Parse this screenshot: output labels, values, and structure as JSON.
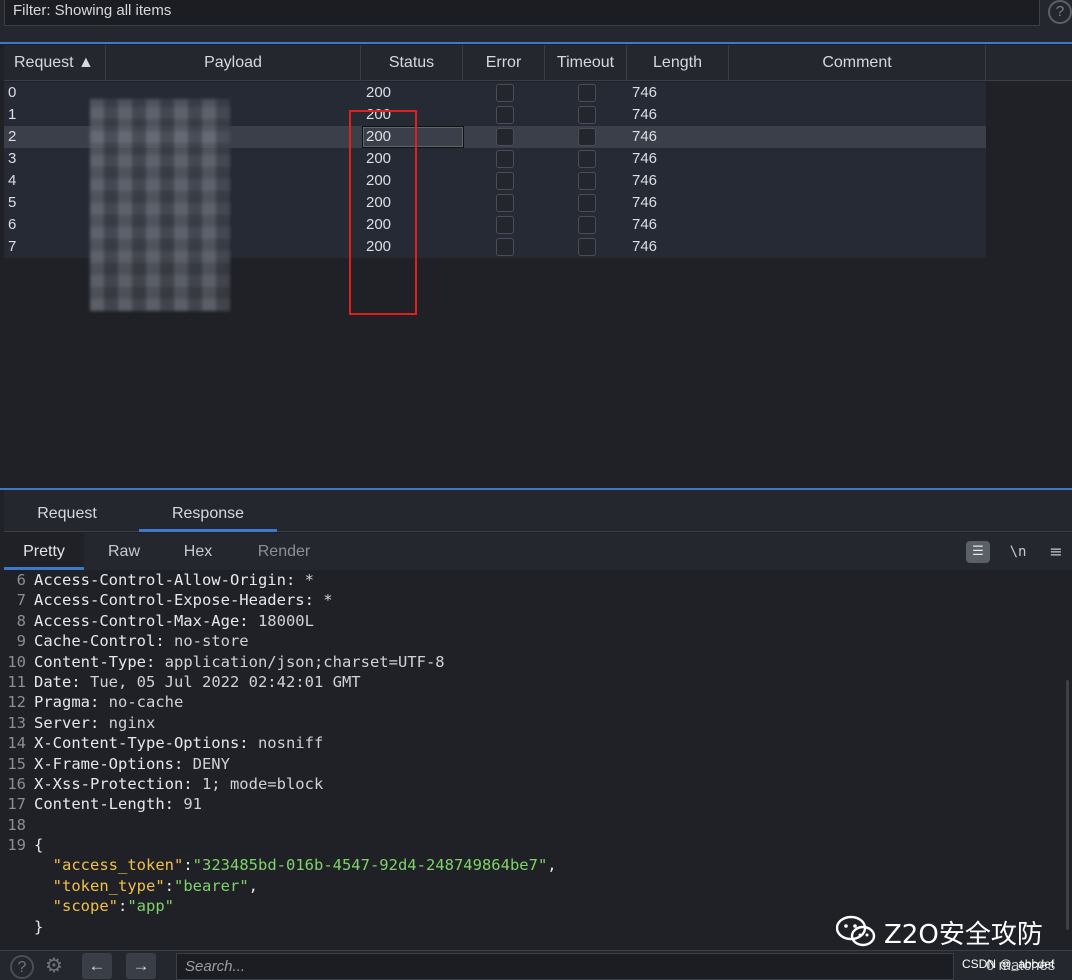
{
  "filter": {
    "text": "Filter: Showing all items",
    "help": "?"
  },
  "table": {
    "columns": {
      "request": "Request ▲",
      "payload": "Payload",
      "status": "Status",
      "error": "Error",
      "timeout": "Timeout",
      "length": "Length",
      "comment": "Comment"
    },
    "rows": [
      {
        "request": "0",
        "status": "200",
        "length": "746"
      },
      {
        "request": "1",
        "status": "200",
        "length": "746"
      },
      {
        "request": "2",
        "status": "200",
        "length": "746"
      },
      {
        "request": "3",
        "status": "200",
        "length": "746"
      },
      {
        "request": "4",
        "status": "200",
        "length": "746"
      },
      {
        "request": "5",
        "status": "200",
        "length": "746"
      },
      {
        "request": "6",
        "status": "200",
        "length": "746"
      },
      {
        "request": "7",
        "status": "200",
        "length": "746"
      }
    ],
    "selected_row": 2,
    "highlight_color": "#e0201e"
  },
  "panel": {
    "tabs": [
      "Request",
      "Response"
    ],
    "active_tab": "Response",
    "subtabs": [
      "Pretty",
      "Raw",
      "Hex",
      "Render"
    ],
    "active_subtab": "Pretty",
    "icons": {
      "wrap": "☰",
      "newline": "\\n",
      "menu": "≡"
    }
  },
  "response_lines": [
    {
      "n": "6",
      "k": "Access-Control-Allow-Origin:",
      "v": " *"
    },
    {
      "n": "7",
      "k": "Access-Control-Expose-Headers:",
      "v": " *"
    },
    {
      "n": "8",
      "k": "Access-Control-Max-Age:",
      "v": " 18000L"
    },
    {
      "n": "9",
      "k": "Cache-Control:",
      "v": " no-store"
    },
    {
      "n": "10",
      "k": "Content-Type:",
      "v": " application/json;charset=UTF-8"
    },
    {
      "n": "11",
      "k": "Date:",
      "v": " Tue, 05 Jul 2022 02:42:01 GMT"
    },
    {
      "n": "12",
      "k": "Pragma:",
      "v": " no-cache"
    },
    {
      "n": "13",
      "k": "Server:",
      "v": " nginx"
    },
    {
      "n": "14",
      "k": "X-Content-Type-Options:",
      "v": " nosniff"
    },
    {
      "n": "15",
      "k": "X-Frame-Options:",
      "v": " DENY"
    },
    {
      "n": "16",
      "k": "X-Xss-Protection:",
      "v": " 1; mode=block"
    },
    {
      "n": "17",
      "k": "Content-Length:",
      "v": " 91"
    },
    {
      "n": "18",
      "k": "",
      "v": ""
    },
    {
      "n": "19",
      "k": "{",
      "v": ""
    }
  ],
  "json_body": [
    {
      "key": "\"access_token\"",
      "value": "\"323485bd-016b-4547-92d4-248749864be7\"",
      "tail": ","
    },
    {
      "key": "\"token_type\"",
      "value": "\"bearer\"",
      "tail": ","
    },
    {
      "key": "\"scope\"",
      "value": "\"app\"",
      "tail": ""
    }
  ],
  "json_close": "}",
  "watermark": {
    "text": "Z2O安全攻防",
    "source": "CSDN @_abcdef"
  },
  "footer": {
    "search_placeholder": "Search...",
    "matches": "0 matches",
    "back": "←",
    "forward": "→",
    "help": "?",
    "settings": "⚙"
  }
}
